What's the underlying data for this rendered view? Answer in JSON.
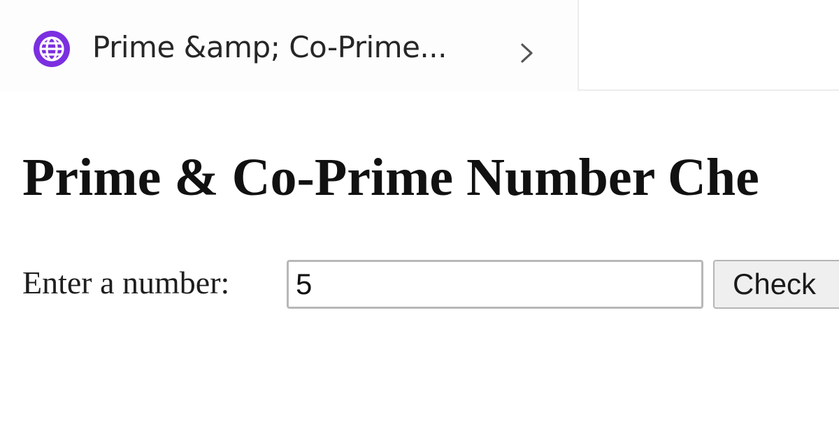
{
  "tab": {
    "title": "Prime &amp; Co-Prime...",
    "icon": "globe-icon",
    "icon_color": "#7b2fe0",
    "chevron_icon": "chevron-right-icon"
  },
  "page": {
    "heading": "Prime & Co-Prime Number Che"
  },
  "form": {
    "label": "Enter a number:",
    "input_value": "5",
    "button_label": "Check"
  }
}
